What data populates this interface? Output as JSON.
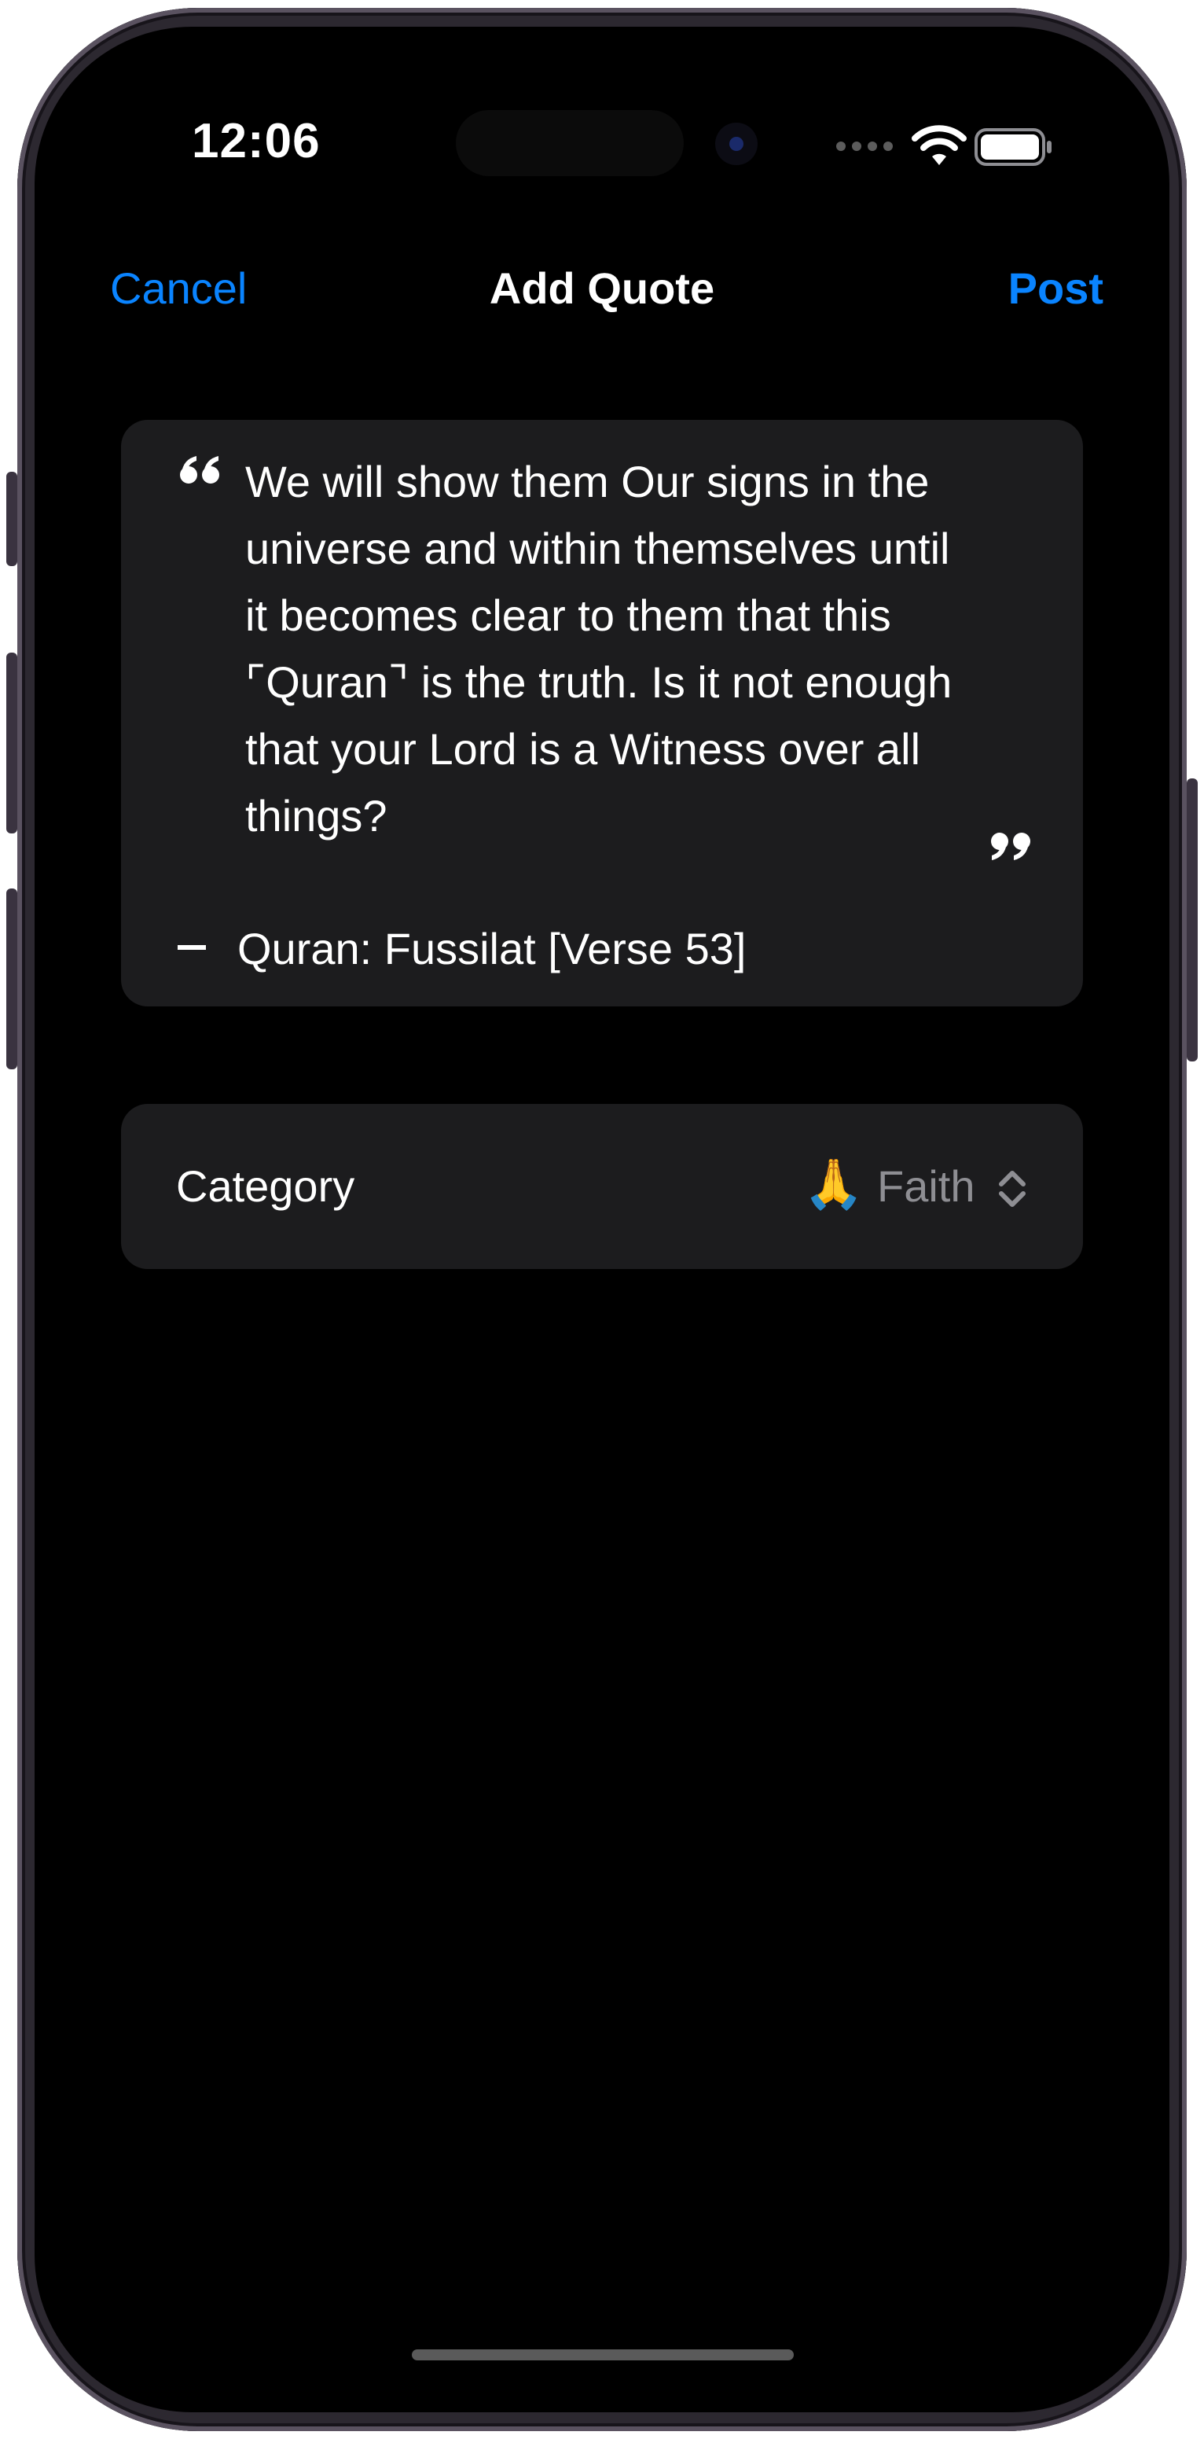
{
  "status_bar": {
    "time": "12:06"
  },
  "nav": {
    "cancel_label": "Cancel",
    "title": "Add Quote",
    "post_label": "Post"
  },
  "quote": {
    "text": "We will show them Our signs in the universe and within themselves until it becomes clear to them that this ⌜Quran⌝ is the truth. Is it not enough that your Lord is a Witness over all things?",
    "source": "Quran: Fussilat [Verse 53]"
  },
  "category": {
    "label": "Category",
    "emoji": "🙏",
    "value": "Faith"
  },
  "colors": {
    "accent": "#0a84ff",
    "background": "#000000",
    "card": "#1c1c1e",
    "secondary_text": "#8e8e93"
  },
  "icons": [
    "wifi-icon",
    "battery-icon",
    "open-quote-icon",
    "close-quote-icon",
    "up-down-chevron-icon"
  ]
}
